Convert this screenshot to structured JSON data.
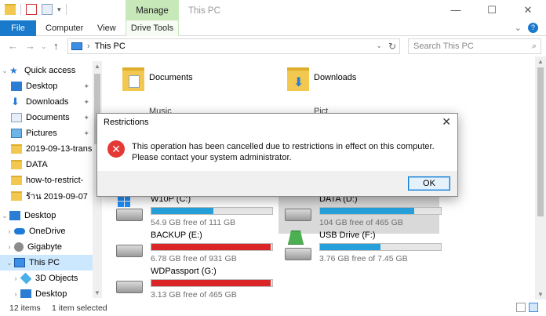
{
  "window": {
    "title": "This PC",
    "context_tab": "Manage",
    "controls": {
      "minimize": "—",
      "maximize": "☐",
      "close": "✕"
    }
  },
  "ribbon": {
    "tabs": [
      {
        "label": "File"
      },
      {
        "label": "Computer"
      },
      {
        "label": "View"
      },
      {
        "label": "Drive Tools"
      }
    ],
    "collapse": "⌄",
    "help": "?"
  },
  "address": {
    "back": "←",
    "forward": "→",
    "recent": "⌄",
    "up": "↑",
    "separator": "›",
    "crumb": "This PC",
    "dropdown": "⌄",
    "refresh": "↻",
    "search_placeholder": "Search This PC",
    "search_icon": "⌕"
  },
  "nav": {
    "items": [
      {
        "label": "Quick access",
        "icon": "star-icon",
        "chev": "⌄",
        "pinned": false
      },
      {
        "label": "Desktop",
        "icon": "desktop-icon",
        "pinned": true
      },
      {
        "label": "Downloads",
        "icon": "download-icon",
        "pinned": true
      },
      {
        "label": "Documents",
        "icon": "documents-icon",
        "pinned": true
      },
      {
        "label": "Pictures",
        "icon": "pictures-icon",
        "pinned": true
      },
      {
        "label": "2019-09-13-trans",
        "icon": "folder-icon",
        "pinned": false
      },
      {
        "label": "DATA",
        "icon": "folder-icon",
        "pinned": false
      },
      {
        "label": "how-to-restrict-",
        "icon": "folder-icon",
        "pinned": false
      },
      {
        "label": "ร้าน 2019-09-07",
        "icon": "folder-icon",
        "pinned": false
      },
      {
        "label": "Desktop",
        "icon": "desktop-icon",
        "chev": "⌄",
        "pinned": false
      },
      {
        "label": "OneDrive",
        "icon": "onedrive-icon",
        "chev": "›",
        "pinned": false
      },
      {
        "label": "Gigabyte",
        "icon": "user-icon",
        "chev": "›",
        "pinned": false
      },
      {
        "label": "This PC",
        "icon": "this-pc-icon",
        "chev": "⌄",
        "pinned": false,
        "selected": true
      },
      {
        "label": "3D Objects",
        "icon": "3d-objects-icon",
        "chev": "›",
        "pinned": false
      },
      {
        "label": "Desktop",
        "icon": "desktop-icon",
        "chev": "›",
        "pinned": false
      }
    ],
    "pin_glyph": "📌"
  },
  "folders": [
    {
      "label": "Documents"
    },
    {
      "label": "Downloads"
    }
  ],
  "partial_labels": {
    "music": "Music",
    "pictures": "Pict"
  },
  "drives": [
    {
      "name": "W10P (C:)",
      "free": "54.9 GB free of 111 GB",
      "used_fraction": 0.51,
      "color": "#26a0da"
    },
    {
      "name": "DATA (D:)",
      "free": "104 GB free of 465 GB",
      "used_fraction": 0.78,
      "color": "#26a0da"
    },
    {
      "name": "BACKUP (E:)",
      "free": "6.78 GB free of 931 GB",
      "used_fraction": 0.99,
      "color": "#da2626"
    },
    {
      "name": "USB Drive (F:)",
      "free": "3.76 GB free of 7.45 GB",
      "used_fraction": 0.5,
      "color": "#26a0da"
    },
    {
      "name": "WDPassport (G:)",
      "free": "3.13 GB free of 465 GB",
      "used_fraction": 0.99,
      "color": "#da2626"
    }
  ],
  "dialog": {
    "title": "Restrictions",
    "close": "✕",
    "error_glyph": "✕",
    "message": "This operation has been cancelled due to restrictions in effect on this computer. Please contact your system administrator.",
    "ok": "OK"
  },
  "status": {
    "count": "12 items",
    "selection": "1 item selected"
  },
  "scroll": {
    "up": "▲",
    "down": "▼"
  }
}
